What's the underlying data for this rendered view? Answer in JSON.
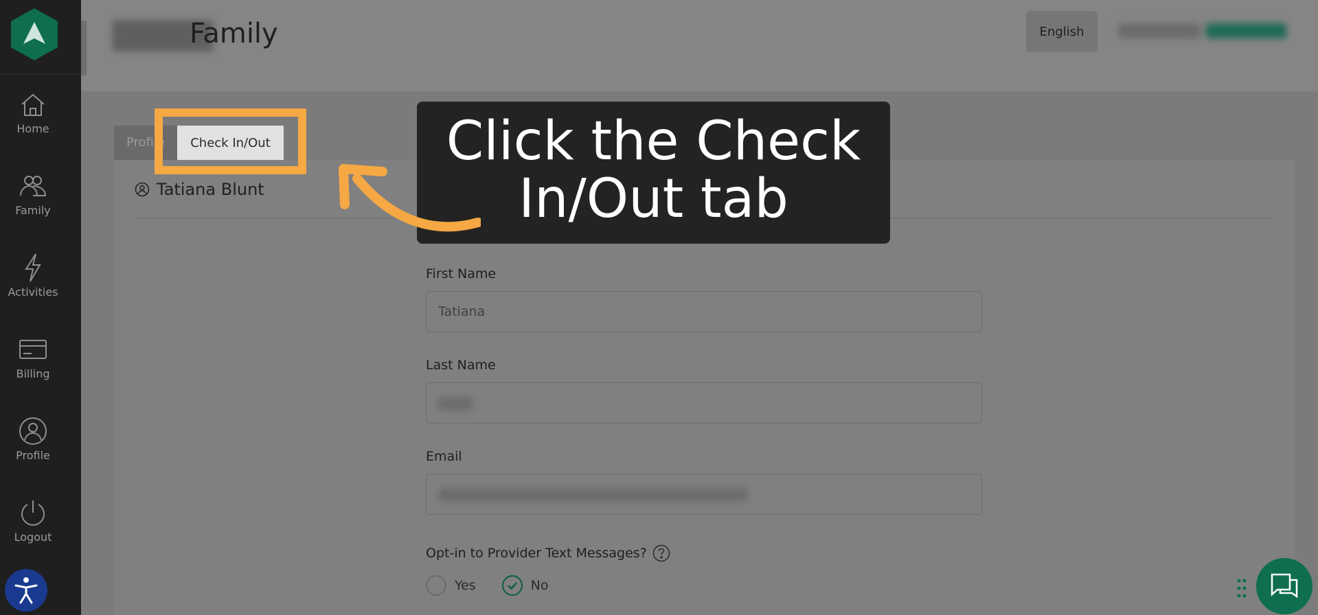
{
  "sidebar": {
    "items": [
      {
        "label": "Home",
        "icon": "home-icon"
      },
      {
        "label": "Family",
        "icon": "family-icon"
      },
      {
        "label": "Activities",
        "icon": "lightning-icon"
      },
      {
        "label": "Billing",
        "icon": "credit-card-icon"
      },
      {
        "label": "Profile",
        "icon": "user-icon"
      },
      {
        "label": "Logout",
        "icon": "power-icon"
      }
    ],
    "accessibility_icon": "accessibility-icon"
  },
  "header": {
    "title": "Family",
    "language_label": "English"
  },
  "tabs": [
    {
      "label": "Profile"
    },
    {
      "label": "Check In/Out"
    }
  ],
  "person": {
    "name": "Tatiana Blunt"
  },
  "form": {
    "first_name": {
      "label": "First Name",
      "value": "Tatiana"
    },
    "last_name": {
      "label": "Last Name"
    },
    "email": {
      "label": "Email"
    },
    "optin": {
      "label": "Opt-in to Provider Text Messages?",
      "yes_label": "Yes",
      "no_label": "No",
      "selected": "No"
    }
  },
  "tooltip": {
    "line1": "Click the Check",
    "line2": "In/Out tab"
  },
  "colors": {
    "accent_green": "#0e6e4f",
    "highlight_orange": "#f5a843",
    "sidebar_bg": "#1f1f1f",
    "tooltip_bg": "#232323"
  }
}
